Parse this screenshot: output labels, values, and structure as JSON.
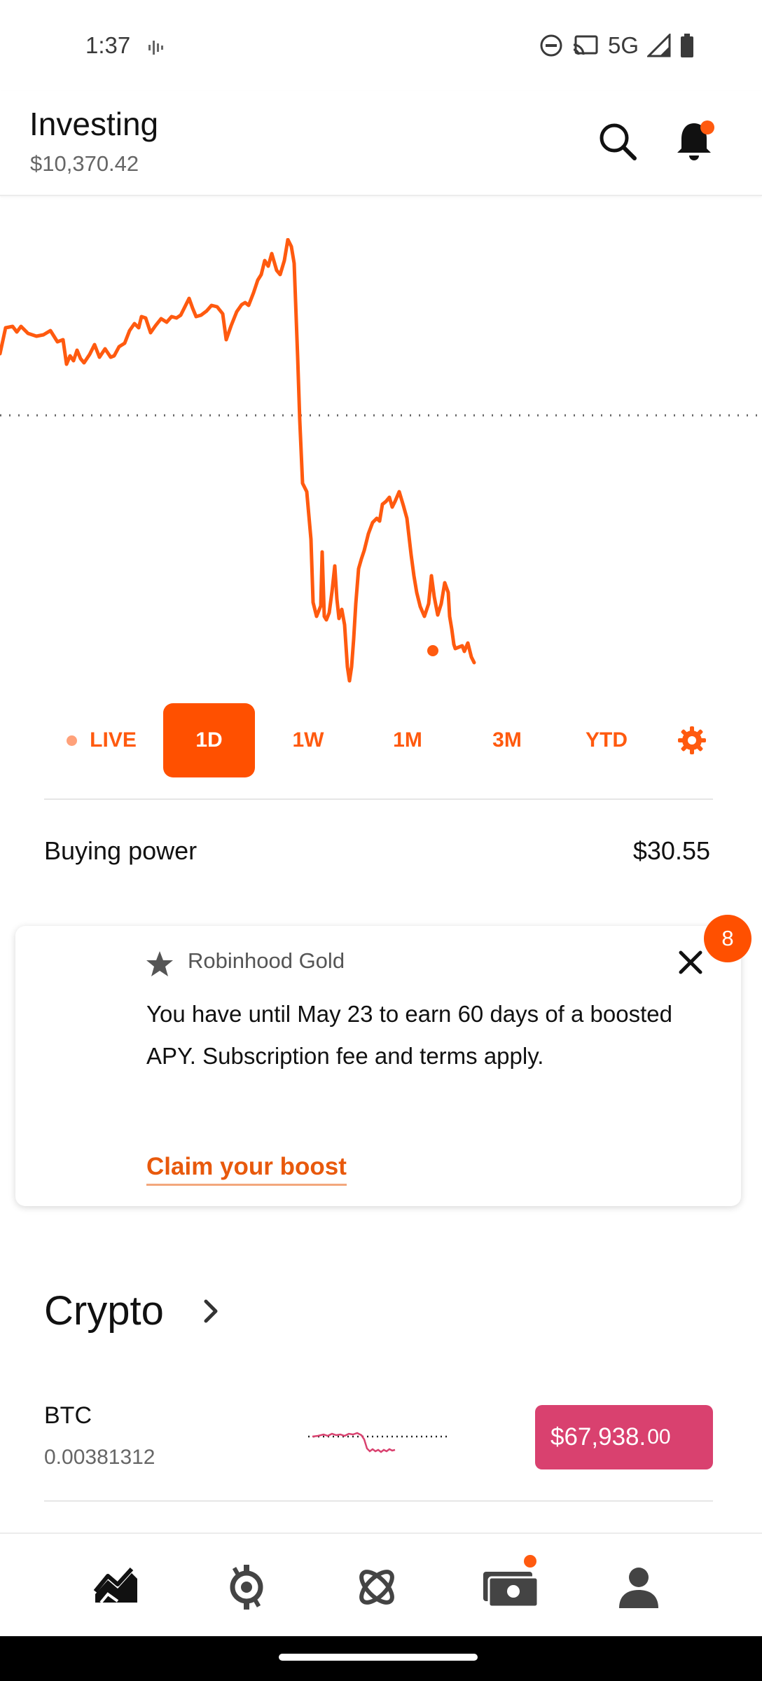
{
  "status_bar": {
    "time": "1:37",
    "network": "5G",
    "icons": [
      "sound-wave-icon",
      "do-not-disturb-icon",
      "cast-icon",
      "signal-icon",
      "battery-icon"
    ]
  },
  "header": {
    "title": "Investing",
    "portfolio_value": "$10,370.42",
    "icons": [
      "search-icon",
      "bell-icon"
    ],
    "has_notification": true
  },
  "chart": {
    "line_color": "#ff5a0f",
    "baseline_style": "dotted",
    "has_end_marker": true
  },
  "time_tabs": [
    {
      "label": "LIVE",
      "active": false
    },
    {
      "label": "1D",
      "active": true
    },
    {
      "label": "1W",
      "active": false
    },
    {
      "label": "1M",
      "active": false
    },
    {
      "label": "3M",
      "active": false
    },
    {
      "label": "YTD",
      "active": false
    }
  ],
  "buying_power": {
    "label": "Buying power",
    "value": "$30.55"
  },
  "gold_card": {
    "badge_count": "8",
    "brand": "Robinhood Gold",
    "message": "You have until May 23 to earn 60 days of a boosted APY. Subscription fee and terms apply.",
    "cta": "Claim your boost"
  },
  "crypto": {
    "title": "Crypto",
    "items": [
      {
        "symbol": "BTC",
        "quantity": "0.00381312",
        "price": "$67,938.",
        "price_trailing": "00",
        "price_color": "#d9416f"
      }
    ]
  },
  "colors": {
    "accent": "#ff5000",
    "crypto_down": "#d9416f"
  },
  "bottom_nav": [
    "chart-icon",
    "browse-icon",
    "crypto-icon",
    "cash-icon",
    "account-icon"
  ]
}
